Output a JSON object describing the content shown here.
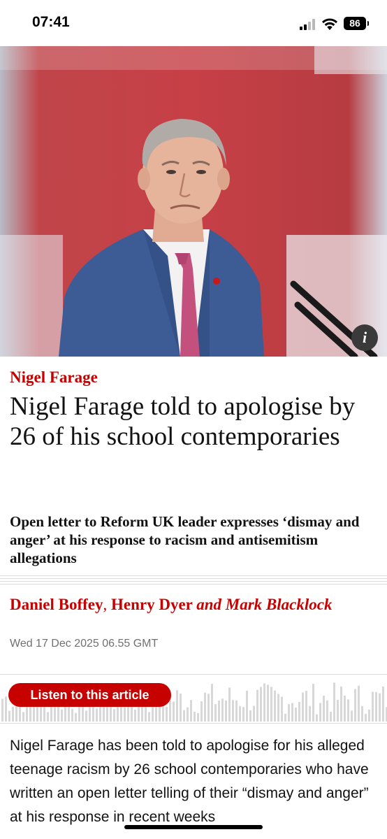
{
  "status_bar": {
    "time": "07:41",
    "battery": "86"
  },
  "hero": {
    "info_label": "i"
  },
  "article": {
    "kicker": "Nigel Farage",
    "headline": "Nigel Farage told to apologise by 26 of his school contemporaries",
    "standfirst": "Open letter to Reform UK leader expresses ‘dismay and anger’ at his response to racism and antisemitism allegations",
    "byline": {
      "author1": "Daniel Boffey",
      "sep": ",",
      "author2": "Henry Dyer",
      "conj": "and",
      "author3": "Mark Blacklock"
    },
    "date": "Wed 17 Dec 2025 06.55 GMT",
    "listen_label": "Listen to this article",
    "body": "Nigel Farage has been told to apologise for his alleged teenage racism by 26 school contemporaries who have written an open letter telling of their “dismay and anger” at his response in recent weeks"
  },
  "colors": {
    "accent": "#c70000",
    "text": "#121212",
    "meta": "#707070"
  }
}
